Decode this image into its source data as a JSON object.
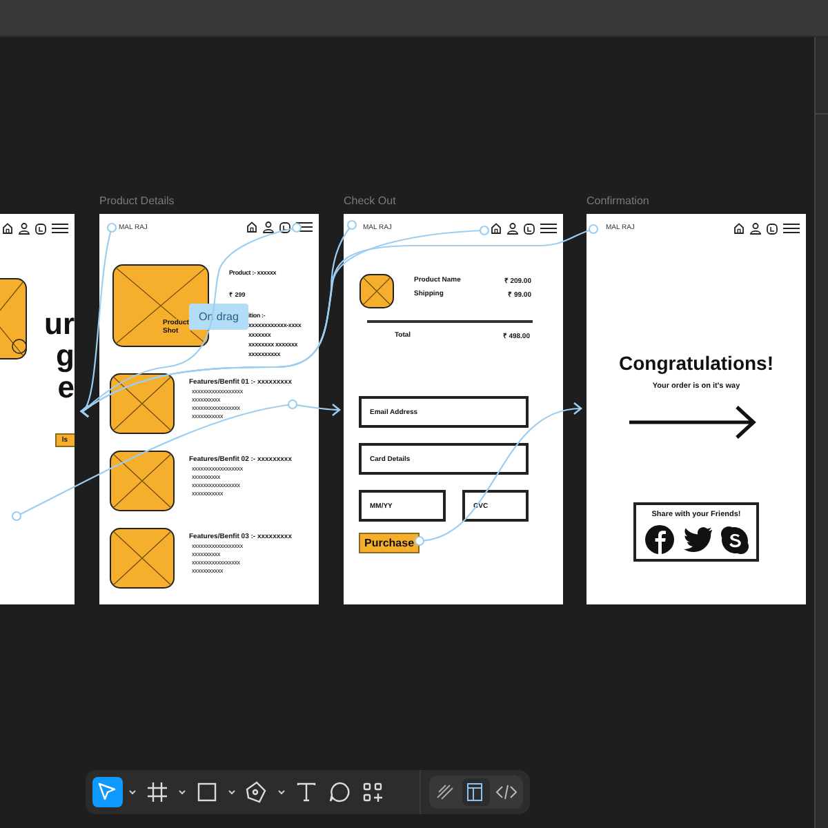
{
  "canvas": {
    "frames": [
      {
        "kind": "landing",
        "heading_lines": [
          "ur",
          "g",
          "e"
        ],
        "button": "ls"
      },
      {
        "kind": "product",
        "title": "Product Details",
        "brand": "MAL RAJ",
        "image_caption": "Product Shot",
        "product_line": "Product :-  xxxxxx",
        "price": "₹ 299",
        "description_lines": [
          "ition :-",
          "xxxxxxxxxxxx-xxxx",
          "xxxxxxx",
          "xxxxxxxx xxxxxxx",
          "xxxxxxxxxx"
        ],
        "features": [
          {
            "heading": "Features/Benfit 01  :-  xxxxxxxxx",
            "lines": [
              "xxxxxxxxxxxxxxxxxx",
              "xxxxxxxxxx",
              "xxxxxxxxxxxxxxxxx",
              "xxxxxxxxxxx"
            ]
          },
          {
            "heading": "Features/Benfit 02  :-  xxxxxxxxx",
            "lines": [
              "xxxxxxxxxxxxxxxxxx",
              "xxxxxxxxxx",
              "xxxxxxxxxxxxxxxxx",
              "xxxxxxxxxxx"
            ]
          },
          {
            "heading": "Features/Benfit 03  :-  xxxxxxxxx",
            "lines": [
              "xxxxxxxxxxxxxxxxxx",
              "xxxxxxxxxx",
              "xxxxxxxxxxxxxxxxx",
              "xxxxxxxxxxx"
            ]
          }
        ]
      },
      {
        "kind": "checkout",
        "title": "Check Out",
        "brand": "MAL RAJ",
        "items": [
          {
            "label": "Product Name",
            "amount": "₹ 209.00"
          },
          {
            "label": "Shipping",
            "amount": "₹  99.00"
          }
        ],
        "total": {
          "label": "Total",
          "amount": "₹ 498.00"
        },
        "fields": [
          {
            "placeholder": "Email Address"
          },
          {
            "placeholder": "Card Details"
          },
          {
            "placeholder": "MM/YY"
          },
          {
            "placeholder": "CVC"
          }
        ],
        "button": "Purchase"
      },
      {
        "kind": "confirmation",
        "title": "Confirmation",
        "brand": "MAL RAJ",
        "heading": "Congratulations!",
        "message": "Your order is on it's way",
        "share_title": "Share with your Friends!",
        "share_icons": [
          {
            "kind": "circle-f"
          },
          {
            "kind": "bird"
          },
          {
            "kind": "circle-s"
          }
        ]
      }
    ],
    "tooltip": "On drag"
  },
  "toolbar": {
    "tools": [
      {
        "kind": "move",
        "selected": true,
        "menu": true
      },
      {
        "kind": "frame",
        "selected": false,
        "menu": true
      },
      {
        "kind": "rectangle",
        "selected": false,
        "menu": true
      },
      {
        "kind": "pen",
        "selected": false,
        "menu": true
      },
      {
        "kind": "text",
        "selected": false,
        "menu": false
      },
      {
        "kind": "comment",
        "selected": false,
        "menu": false
      },
      {
        "kind": "components",
        "selected": false,
        "menu": false
      }
    ],
    "modes": [
      {
        "kind": "draw",
        "selected": false
      },
      {
        "kind": "design",
        "selected": true
      },
      {
        "kind": "dev",
        "selected": false
      }
    ]
  }
}
